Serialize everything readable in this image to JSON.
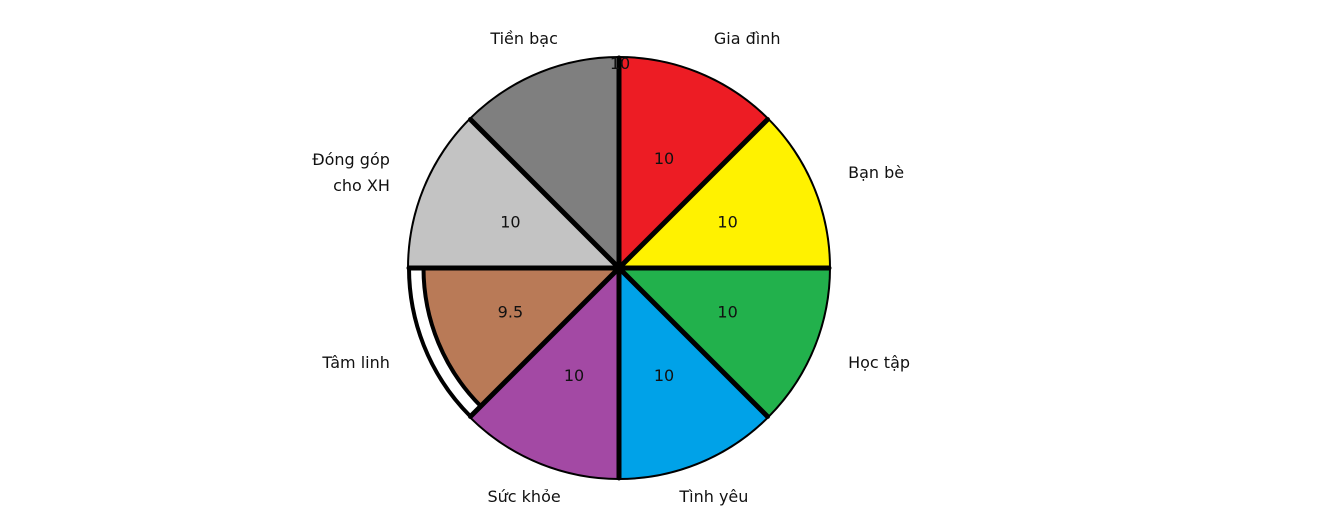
{
  "chart_data": {
    "type": "radial-bar",
    "scale_max": 10,
    "scale_label": "10",
    "start": "top",
    "direction": "clockwise",
    "segments": [
      {
        "name": "Gia đình",
        "value": 10,
        "value_label": "10",
        "color": "#ed1c24"
      },
      {
        "name": "Bạn bè",
        "value": 10,
        "value_label": "10",
        "color": "#fff200"
      },
      {
        "name": "Học tập",
        "value": 10,
        "value_label": "10",
        "color": "#22b14c"
      },
      {
        "name": "Tình yêu",
        "value": 10,
        "value_label": "10",
        "color": "#00a2e8"
      },
      {
        "name": "Sức khỏe",
        "value": 10,
        "value_label": "10",
        "color": "#a349a4"
      },
      {
        "name": "Tâm linh",
        "value": 9.5,
        "value_label": "9.5",
        "color": "#b97a57"
      },
      {
        "name": "Đóng góp cho XH",
        "value": 10,
        "value_label": "10",
        "color": "#c3c3c3"
      },
      {
        "name": "Tiền bạc",
        "value": 10,
        "value_label": "",
        "color": "#7f7f7f"
      }
    ],
    "outline_color": "#000000"
  }
}
